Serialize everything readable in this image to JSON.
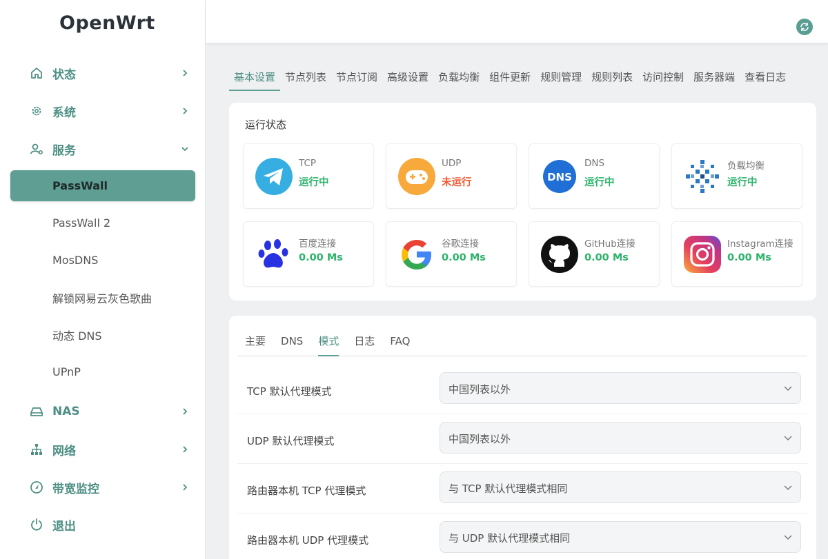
{
  "app": {
    "logo": "OpenWrt",
    "refresh_icon": "refresh-icon"
  },
  "sidebar": {
    "items": [
      {
        "label": "状态",
        "icon": "home-icon"
      },
      {
        "label": "系统",
        "icon": "gear-icon"
      },
      {
        "label": "服务",
        "icon": "user-gear-icon"
      },
      {
        "label": "NAS",
        "icon": "drive-icon"
      },
      {
        "label": "网络",
        "icon": "network-icon"
      },
      {
        "label": "带宽监控",
        "icon": "gauge-icon"
      },
      {
        "label": "退出",
        "icon": "power-icon"
      }
    ],
    "sub_items": [
      {
        "label": "PassWall",
        "active": true
      },
      {
        "label": "PassWall 2"
      },
      {
        "label": "MosDNS"
      },
      {
        "label": "解锁网易云灰色歌曲"
      },
      {
        "label": "动态 DNS"
      },
      {
        "label": "UPnP"
      }
    ]
  },
  "tabs": [
    "基本设置",
    "节点列表",
    "节点订阅",
    "高级设置",
    "负载均衡",
    "组件更新",
    "规则管理",
    "规则列表",
    "访问控制",
    "服务器端",
    "查看日志"
  ],
  "status": {
    "title": "运行状态",
    "tiles": [
      {
        "name": "TCP",
        "value": "运行中",
        "icon": "telegram-icon"
      },
      {
        "name": "UDP",
        "value": "未运行",
        "icon": "gamepad-icon"
      },
      {
        "name": "DNS",
        "value": "运行中",
        "icon": "dns-icon",
        "icon_text": "DNS"
      },
      {
        "name": "负载均衡",
        "value": "运行中",
        "icon": "load-balance-icon"
      },
      {
        "name": "百度连接",
        "value": "0.00 Ms",
        "icon": "baidu-icon"
      },
      {
        "name": "谷歌连接",
        "value": "0.00 Ms",
        "icon": "google-icon"
      },
      {
        "name": "GitHub连接",
        "value": "0.00 Ms",
        "icon": "github-icon"
      },
      {
        "name": "Instagram连接",
        "value": "0.00 Ms",
        "icon": "instagram-icon"
      }
    ]
  },
  "settings": {
    "tabs": [
      "主要",
      "DNS",
      "模式",
      "日志",
      "FAQ"
    ],
    "active_tab": "模式",
    "rows": [
      {
        "label": "TCP 默认代理模式",
        "value": "中国列表以外"
      },
      {
        "label": "UDP 默认代理模式",
        "value": "中国列表以外"
      },
      {
        "label": "路由器本机 TCP 代理模式",
        "value": "与 TCP 默认代理模式相同"
      },
      {
        "label": "路由器本机 UDP 代理模式",
        "value": "与 UDP 默认代理模式相同"
      }
    ]
  },
  "colors": {
    "accent": "#5e9e93",
    "running": "#2db36b",
    "stopped": "#ef5b34"
  }
}
